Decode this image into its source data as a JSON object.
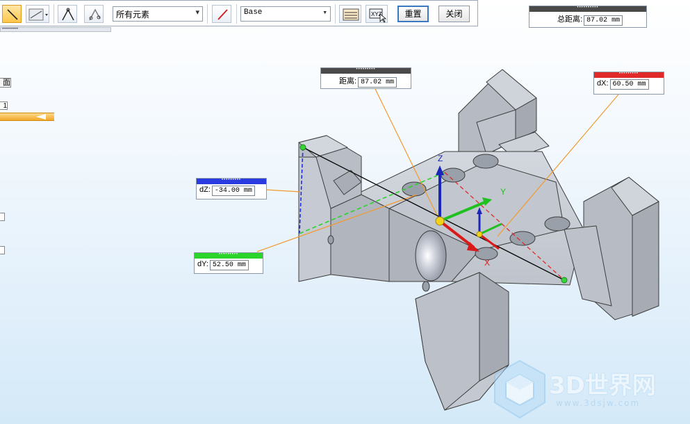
{
  "toolbar": {
    "filter_combo_value": "所有元素",
    "coord_combo_value": "Base",
    "reset_label": "重置",
    "close_label": "关闭"
  },
  "side_panel": {
    "face_label": "面",
    "index_value": "1"
  },
  "measurements": {
    "total": {
      "label": "总距离:",
      "value": "87.02 mm",
      "color": "#4a4a4a"
    },
    "distance": {
      "label": "距离:",
      "value": "87.02 mm",
      "color": "#4a4a4a"
    },
    "dx": {
      "label": "dX:",
      "value": "60.50 mm",
      "color": "#e02a2a"
    },
    "dz": {
      "label": "dZ:",
      "value": "-34.00 mm",
      "color": "#2a3be0"
    },
    "dy": {
      "label": "dY:",
      "value": "52.50 mm",
      "color": "#2ad42a"
    }
  },
  "axes": {
    "z_label": "Z",
    "x_label": "X",
    "y_label": "Y"
  },
  "watermark": {
    "brand": "3D世界网",
    "url": "www.3dsjw.com"
  },
  "colors": {
    "part_gray": "#b9bec8",
    "edge": "#3d3d3d",
    "measure_line": "#000000",
    "leader": "#f29a2e"
  }
}
